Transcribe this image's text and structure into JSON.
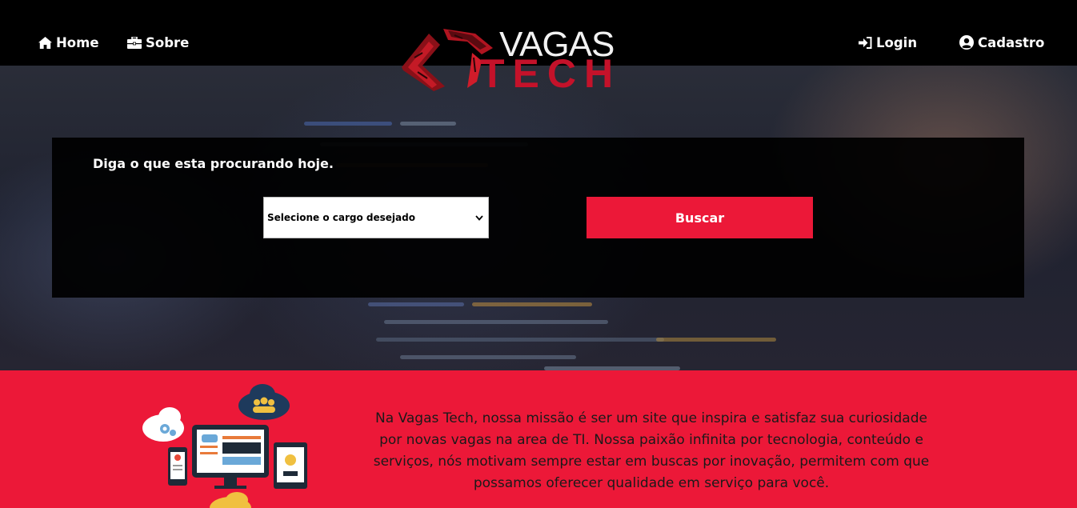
{
  "nav": {
    "home": {
      "label": "Home",
      "icon": "home-icon"
    },
    "about": {
      "label": "Sobre",
      "icon": "briefcase-icon"
    },
    "login": {
      "label": "Login",
      "icon": "sign-in-icon"
    },
    "register": {
      "label": "Cadastro",
      "icon": "user-circle-icon"
    }
  },
  "logo": {
    "word1": "VAGAS",
    "word2": "TECH"
  },
  "search": {
    "heading": "Diga o que esta procurando hoje.",
    "select_value": "Selecione o cargo desejado",
    "button_label": "Buscar"
  },
  "about": {
    "text": "Na Vagas Tech, nossa missão é ser um site que inspira e satisfaz sua curiosidade por novas vagas na area de TI. Nossa paixão infinita por tecnologia, conteúdo e serviços, nós motivam sempre estar em buscas por inovação, permitem com que possamos oferecer qualidade em serviço para você."
  },
  "colors": {
    "accent": "#ec1838",
    "logo_red": "#c4122a",
    "navbar": "#000000"
  }
}
